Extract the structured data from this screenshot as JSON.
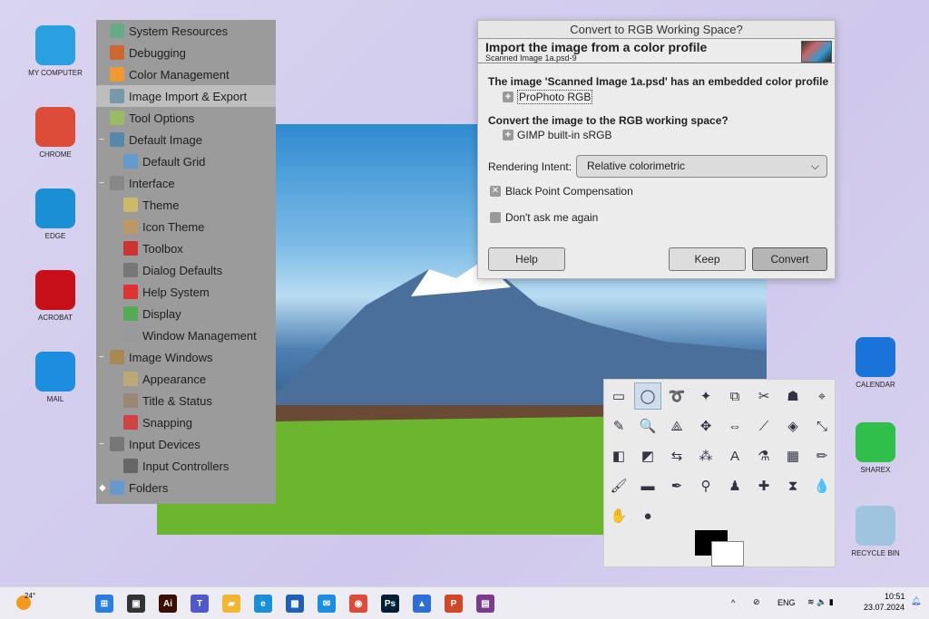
{
  "desktop": {
    "left": [
      "MY COMPUTER",
      "CHROME",
      "EDGE",
      "ACROBAT",
      "MAIL"
    ],
    "right": [
      "CALENDAR",
      "SHAREX",
      "RECYCLE BIN"
    ]
  },
  "prefs_tree": [
    {
      "label": "System Resources",
      "level": 0,
      "exp": ""
    },
    {
      "label": "Debugging",
      "level": 0,
      "exp": ""
    },
    {
      "label": "Color Management",
      "level": 0,
      "exp": ""
    },
    {
      "label": "Image Import & Export",
      "level": 0,
      "exp": "",
      "selected": true
    },
    {
      "label": "Tool Options",
      "level": 0,
      "exp": ""
    },
    {
      "label": "Default Image",
      "level": 0,
      "exp": "−"
    },
    {
      "label": "Default Grid",
      "level": 1,
      "exp": ""
    },
    {
      "label": "Interface",
      "level": 0,
      "exp": "−"
    },
    {
      "label": "Theme",
      "level": 1,
      "exp": ""
    },
    {
      "label": "Icon Theme",
      "level": 1,
      "exp": ""
    },
    {
      "label": "Toolbox",
      "level": 1,
      "exp": ""
    },
    {
      "label": "Dialog Defaults",
      "level": 1,
      "exp": ""
    },
    {
      "label": "Help System",
      "level": 1,
      "exp": ""
    },
    {
      "label": "Display",
      "level": 1,
      "exp": ""
    },
    {
      "label": "Window Management",
      "level": 1,
      "exp": ""
    },
    {
      "label": "Image Windows",
      "level": 0,
      "exp": "−"
    },
    {
      "label": "Appearance",
      "level": 1,
      "exp": ""
    },
    {
      "label": "Title & Status",
      "level": 1,
      "exp": ""
    },
    {
      "label": "Snapping",
      "level": 1,
      "exp": ""
    },
    {
      "label": "Input Devices",
      "level": 0,
      "exp": "−"
    },
    {
      "label": "Input Controllers",
      "level": 1,
      "exp": ""
    },
    {
      "label": "Folders",
      "level": 0,
      "exp": "◆"
    }
  ],
  "dialog": {
    "title": "Convert to RGB Working Space?",
    "header": "Import the image from a color profile",
    "subheader": "Scanned Image 1a.psd-9",
    "embedded_text": "The image 'Scanned Image 1a.psd' has an embedded color profile",
    "embedded_profile": "ProPhoto RGB",
    "convert_question": "Convert the image to the RGB working space?",
    "working_profile": "GIMP built-in sRGB",
    "intent_label": "Rendering Intent:",
    "intent_value": "Relative colorimetric",
    "bpc_label": "Black Point Compensation",
    "bpc_checked": true,
    "dont_ask_label": "Don't ask me again",
    "dont_ask_checked": false,
    "help": "Help",
    "keep": "Keep",
    "convert": "Convert"
  },
  "toolbox": {
    "tools": [
      "▭",
      "◯",
      "➰",
      "✦",
      "⧉",
      "✂",
      "☗",
      "⌖",
      "✎",
      "🔍",
      "⟁",
      "✥",
      "⇔",
      "⟋",
      "◈",
      "⤡",
      "◧",
      "◩",
      "⇆",
      "⁂",
      "A",
      "⚗",
      "▦",
      "✏",
      "🖌",
      "▬",
      "✒",
      "⚲",
      "♟",
      "✚",
      "⧗",
      "💧",
      "✋",
      "●"
    ]
  },
  "taskbar": {
    "weather": "24°",
    "lang": "ENG",
    "time": "10:51",
    "date": "23.07.2024",
    "apps": [
      {
        "n": "start",
        "c": "#2a7de1",
        "t": "⊞"
      },
      {
        "n": "task-view",
        "c": "#333",
        "t": "▣"
      },
      {
        "n": "illustrator",
        "c": "#3a0d00",
        "t": "Ai"
      },
      {
        "n": "teams",
        "c": "#5059c9",
        "t": "T"
      },
      {
        "n": "file-explorer",
        "c": "#f2b632",
        "t": "▰"
      },
      {
        "n": "edge",
        "c": "#1a8fd6",
        "t": "e"
      },
      {
        "n": "store",
        "c": "#1f5fb6",
        "t": "▦"
      },
      {
        "n": "mail",
        "c": "#1d8de0",
        "t": "✉"
      },
      {
        "n": "chrome",
        "c": "#dd4b39",
        "t": "◉"
      },
      {
        "n": "photoshop",
        "c": "#001e36",
        "t": "Ps"
      },
      {
        "n": "photos",
        "c": "#2d6fd6",
        "t": "▲"
      },
      {
        "n": "powerpoint",
        "c": "#d24726",
        "t": "P"
      },
      {
        "n": "winrar",
        "c": "#7a3b8c",
        "t": "▤"
      }
    ]
  }
}
